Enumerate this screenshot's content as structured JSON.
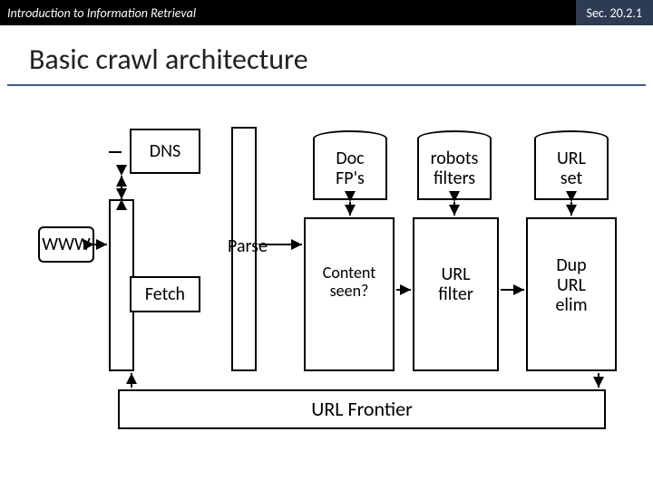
{
  "header": {
    "left": "Introduction to Information Retrieval",
    "right": "Sec. 20.2.1"
  },
  "title": "Basic crawl architecture",
  "nodes": {
    "www": "WWW",
    "dns": "DNS",
    "fetch": "Fetch",
    "parse": "Parse",
    "docfps": "Doc\nFP's",
    "content_seen": "Content\nseen?",
    "robots": "robots\nfilters",
    "url_filter": "URL\nfilter",
    "url_set": "URL\nset",
    "dup_url_elim": "Dup\nURL\nelim",
    "url_frontier": "URL Frontier"
  }
}
